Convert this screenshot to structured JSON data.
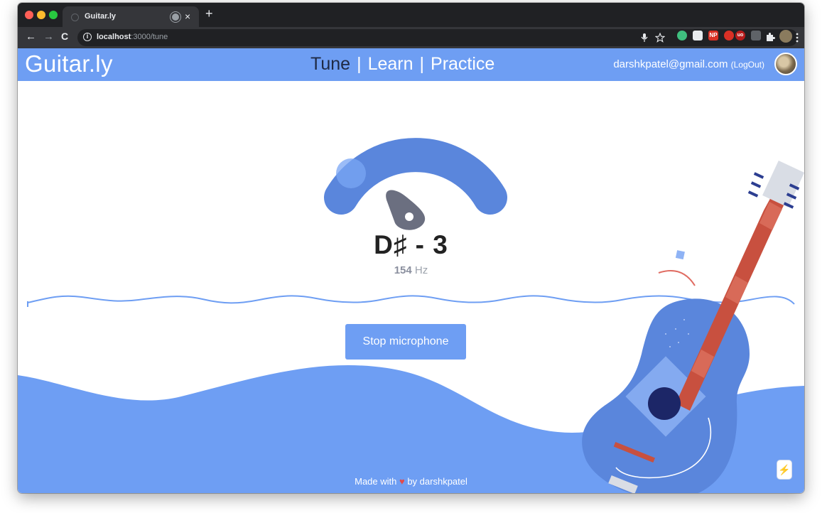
{
  "browser": {
    "tab_title": "Guitar.ly",
    "close_glyph": "×",
    "new_tab_glyph": "+",
    "url_host": "localhost",
    "url_path": ":3000/tune",
    "back_glyph": "←",
    "forward_glyph": "→",
    "reload_glyph": "C",
    "info_glyph": "i",
    "ext_np_label": "NP",
    "ext_ub_label": "uo"
  },
  "header": {
    "brand": "Guitar.ly",
    "nav": [
      {
        "label": "Tune",
        "active": true
      },
      {
        "label": "Learn",
        "active": false
      },
      {
        "label": "Practice",
        "active": false
      }
    ],
    "separator": "|",
    "email": "darshkpatel@gmail.com",
    "logout_label": "(LogOut)"
  },
  "tuner": {
    "note": "D♯ - 3",
    "frequency_value": "154",
    "frequency_unit": "Hz"
  },
  "actions": {
    "stop_label": "Stop microphone"
  },
  "footer": {
    "prefix": "Made with",
    "heart": "♥",
    "suffix": "by darshkpatel"
  },
  "widget": {
    "bolt_glyph": "⚡"
  },
  "colors": {
    "brand_blue": "#6e9ef3",
    "gauge_blue": "#5a86dc",
    "pick_gray": "#6b6f80",
    "neck_red": "#c8503f",
    "guitar_body": "#5a86dc",
    "active_nav": "#1f2a44"
  }
}
